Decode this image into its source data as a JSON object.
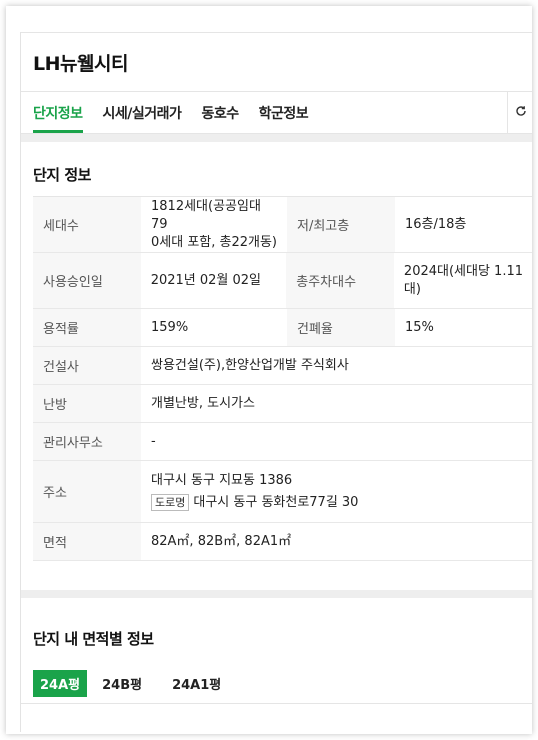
{
  "header": {
    "title": "LH뉴웰시티"
  },
  "tabs": [
    {
      "label": "단지정보",
      "active": true
    },
    {
      "label": "시세/실거래가",
      "active": false
    },
    {
      "label": "동호수",
      "active": false
    },
    {
      "label": "학군정보",
      "active": false
    }
  ],
  "refresh_icon": "refresh-icon",
  "complex_info": {
    "title": "단지 정보",
    "rows": {
      "households": {
        "label": "세대수",
        "value_line1": "1812세대(공공임대 79",
        "value_line2": "0세대 포함, 총22개동)"
      },
      "floors": {
        "label": "저/최고층",
        "value": "16층/18층"
      },
      "approval": {
        "label": "사용승인일",
        "value": "2021년 02월 02일"
      },
      "parking": {
        "label": "총주차대수",
        "value_line1": "2024대(세대당 1.11",
        "value_line2": "대)"
      },
      "far": {
        "label": "용적률",
        "value": "159%"
      },
      "bcr": {
        "label": "건폐율",
        "value": "15%"
      },
      "builder": {
        "label": "건설사",
        "value": "쌍용건설(주),한양산업개발 주식회사"
      },
      "heating": {
        "label": "난방",
        "value": "개별난방, 도시가스"
      },
      "office": {
        "label": "관리사무소",
        "value": "-"
      },
      "address": {
        "label": "주소",
        "lot": "대구시 동구 지묘동 1386",
        "road_tag": "도로명",
        "road": "대구시 동구 동화천로77길 30"
      },
      "area": {
        "label": "면적",
        "value": "82A㎡, 82B㎡, 82A1㎡"
      }
    }
  },
  "area_info": {
    "title": "단지 내 면적별 정보",
    "tabs": [
      {
        "label": "24A평",
        "active": true
      },
      {
        "label": "24B평",
        "active": false
      },
      {
        "label": "24A1평",
        "active": false
      }
    ]
  },
  "colors": {
    "accent": "#1aa34a",
    "label_bg": "#f7f7f7",
    "divider": "#eeeeee"
  }
}
